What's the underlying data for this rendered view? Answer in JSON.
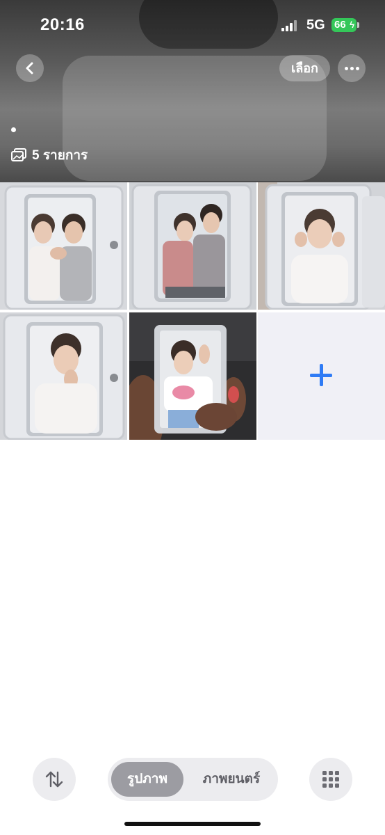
{
  "status_bar": {
    "time": "20:16",
    "network": "5G",
    "battery": "66"
  },
  "header": {
    "select_label": "เลือก",
    "item_count": "5 รายการ"
  },
  "icons": {
    "back": "chevron-left-icon",
    "more": "ellipsis-icon",
    "photos": "photos-stack-icon",
    "add": "plus-icon",
    "sort": "sort-arrows-icon",
    "grid": "grid-icon"
  },
  "grid": {
    "photos": [
      {
        "subject": "two people making heart"
      },
      {
        "subject": "two people seated"
      },
      {
        "subject": "person heart hands"
      },
      {
        "subject": "person hand on chin"
      },
      {
        "subject": "person peace sign in sleeve"
      }
    ]
  },
  "bottom_bar": {
    "tab_photos": "รูปภาพ",
    "tab_videos": "ภาพยนตร์"
  },
  "colors": {
    "accent": "#2f7bf5",
    "battery": "#34c759",
    "add_cell_bg": "#f0f0f6"
  }
}
